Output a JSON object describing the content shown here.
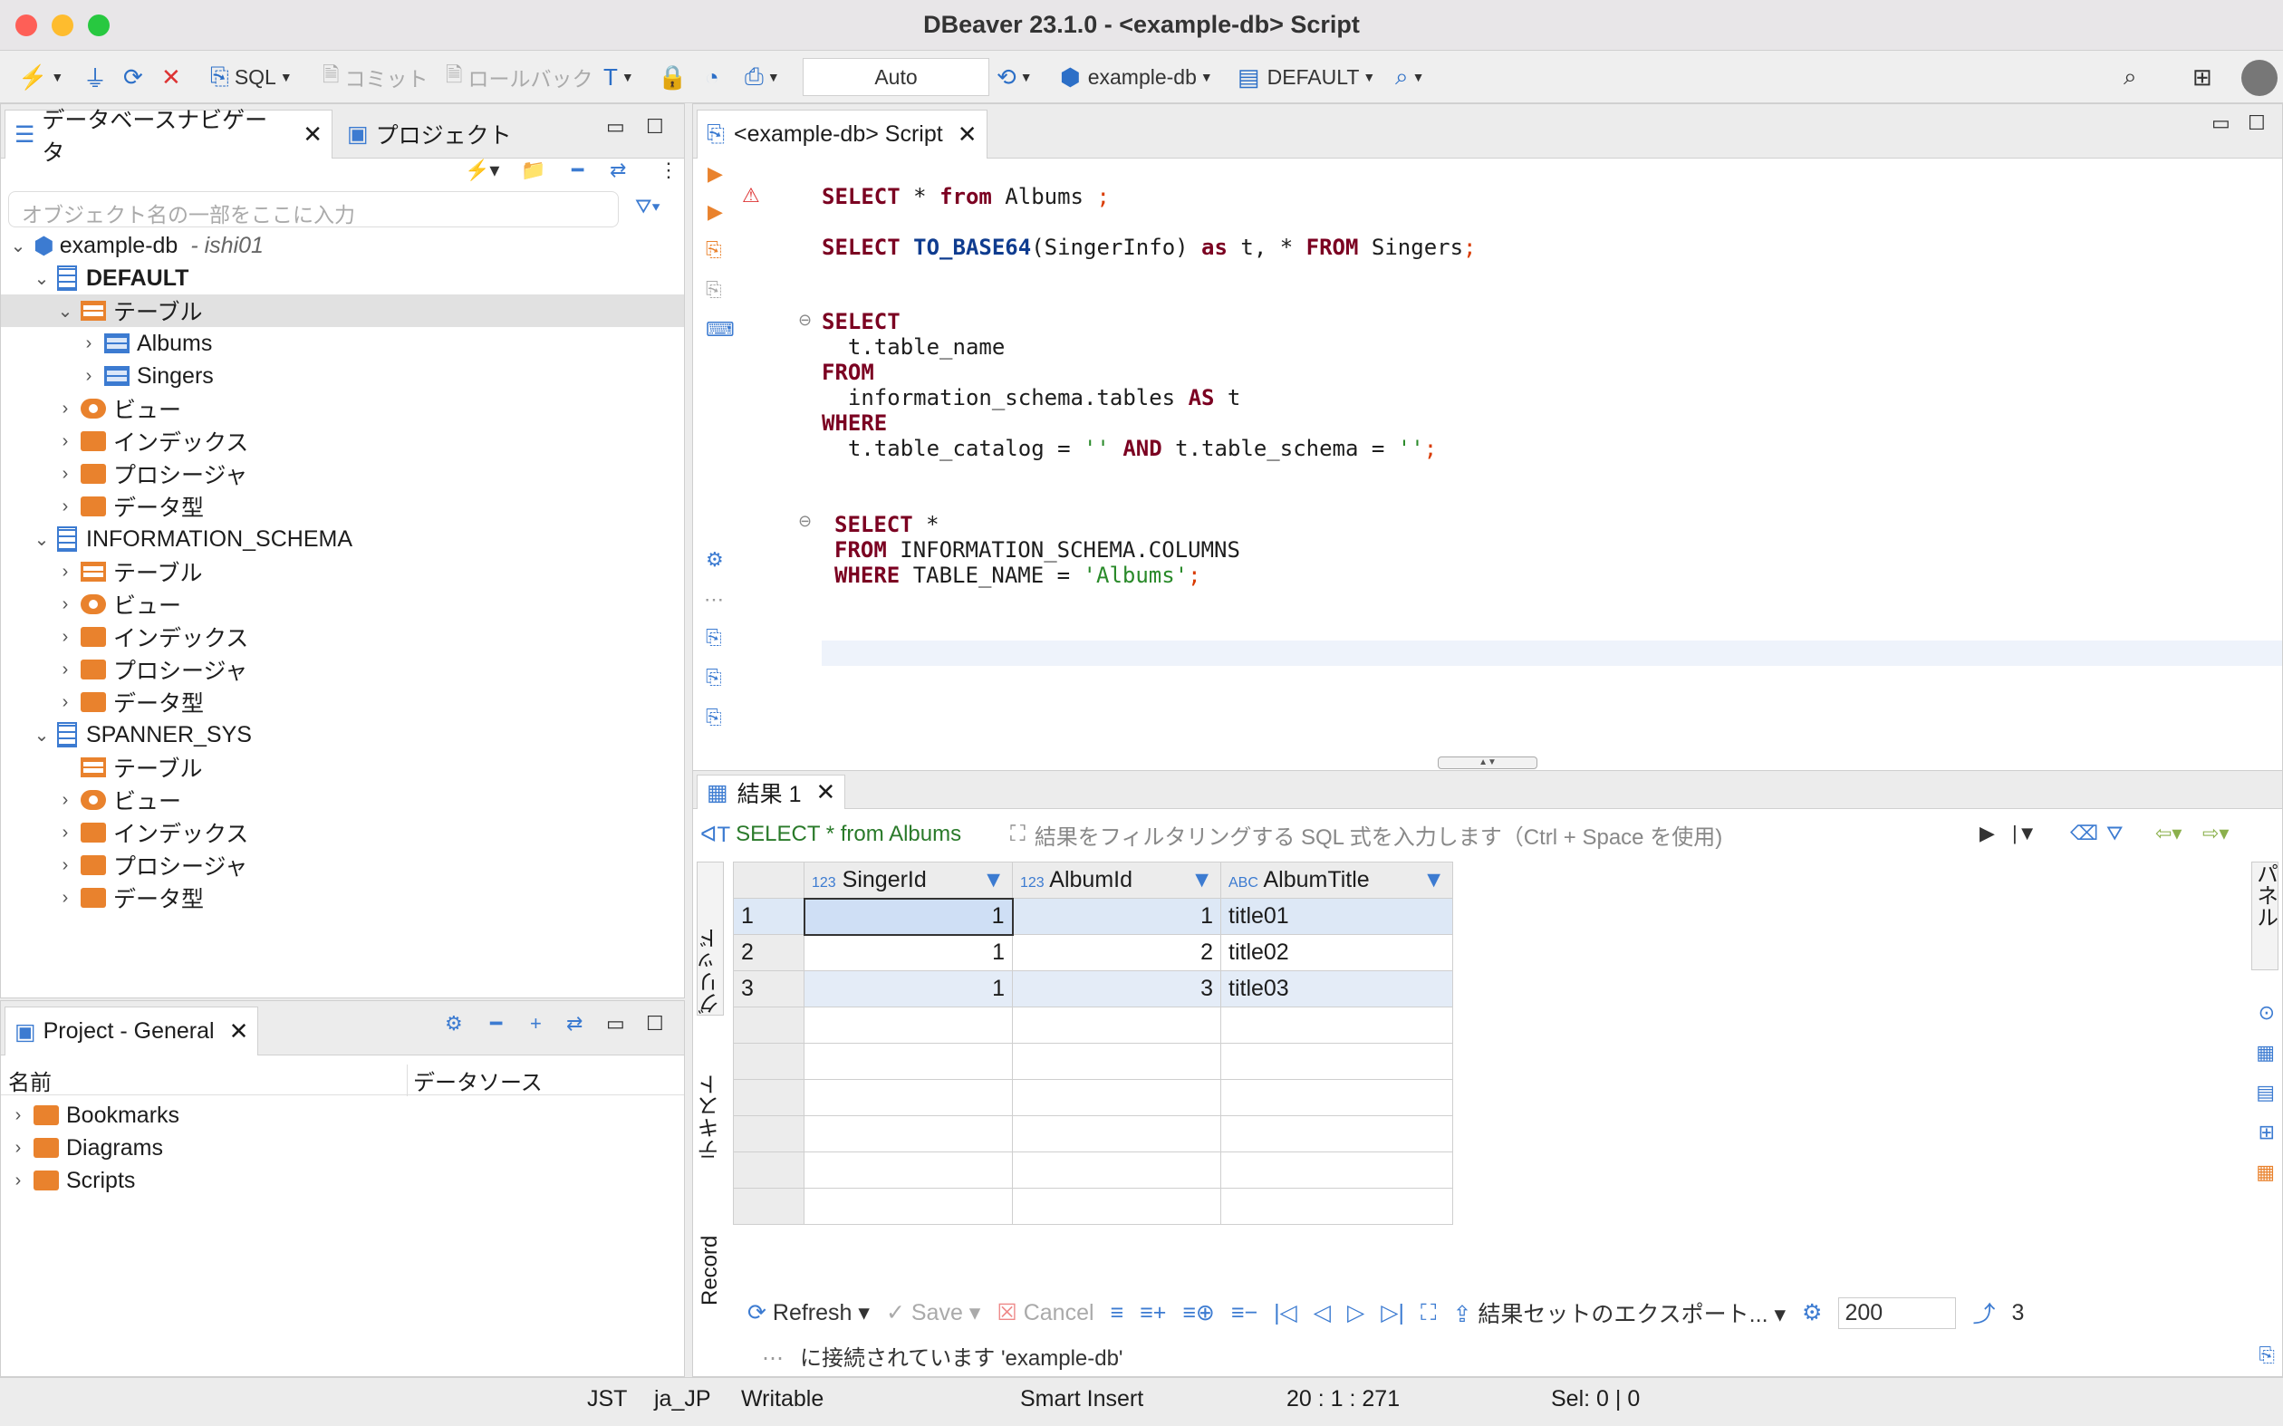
{
  "window": {
    "title": "DBeaver 23.1.0 - <example-db> Script"
  },
  "toolbar": {
    "sql_label": "SQL",
    "commit_label": "コミット",
    "rollback_label": "ロールバック",
    "transaction_mode": "Auto",
    "datasource": "example-db",
    "schema": "DEFAULT"
  },
  "navigator": {
    "tab_label": "データベースナビゲータ",
    "project_tab_label": "プロジェクト",
    "filter_placeholder": "オブジェクト名の一部をここに入力",
    "connection": "example-db",
    "connection_user": "- ishi01",
    "schema_default": "DEFAULT",
    "tables": "テーブル",
    "table_albums": "Albums",
    "table_singers": "Singers",
    "views": "ビュー",
    "indexes": "インデックス",
    "procedures": "プロシージャ",
    "datatypes": "データ型",
    "schema_info": "INFORMATION_SCHEMA",
    "schema_spanner": "SPANNER_SYS"
  },
  "project": {
    "tab_label": "Project - General",
    "col_name": "名前",
    "col_datasource": "データソース",
    "items": [
      "Bookmarks",
      "Diagrams",
      "Scripts"
    ]
  },
  "editor": {
    "tab_label": "<example-db> Script",
    "lines": {
      "q1_select": "SELECT",
      "q1_star": " * ",
      "q1_from": "from",
      "q1_rest": " Albums ",
      "q1_semi": ";",
      "q2_select": "SELECT",
      "q2_fn": "TO_BASE64",
      "q2_args": "(SingerInfo) ",
      "q2_as": "as",
      "q2_mid": " t, * ",
      "q2_from": "FROM",
      "q2_rest": " Singers",
      "q2_semi": ";",
      "q3_select": "SELECT",
      "q3_col": "  t.table_name",
      "q3_from": "FROM",
      "q3_tbl": "  information_schema.tables ",
      "q3_as": "AS",
      "q3_alias": " t",
      "q3_where": "WHERE",
      "q3_cond1": "  t.table_catalog = ",
      "q3_str1": "''",
      "q3_and": "AND",
      "q3_cond2": " t.table_schema = ",
      "q3_str2": "''",
      "q3_semi": ";",
      "q4_select": "SELECT",
      "q4_star": " *",
      "q4_from": "FROM",
      "q4_tbl": " INFORMATION_SCHEMA.COLUMNS",
      "q4_where": "WHERE",
      "q4_cond": " TABLE_NAME = ",
      "q4_str": "'Albums'",
      "q4_semi": ";"
    }
  },
  "results": {
    "tab_label": "結果 1",
    "query_label": "SELECT * from Albums",
    "filter_placeholder": "結果をフィルタリングする SQL 式を入力します（Ctrl + Space を使用)",
    "columns": [
      "SingerId",
      "AlbumId",
      "AlbumTitle"
    ],
    "rows": [
      {
        "n": "1",
        "singer": "1",
        "album": "1",
        "title": "title01"
      },
      {
        "n": "2",
        "singer": "1",
        "album": "2",
        "title": "title02"
      },
      {
        "n": "3",
        "singer": "1",
        "album": "3",
        "title": "title03"
      }
    ],
    "side_grid": "グリッド",
    "side_text": "テキスト",
    "side_record": "Record",
    "side_panel": "パネル",
    "refresh": "Refresh",
    "save": "Save",
    "cancel": "Cancel",
    "export": "結果セットのエクスポート...",
    "fetch_size": "200",
    "row_count": "3",
    "connection_status": "に接続されています 'example-db'"
  },
  "statusbar": {
    "tz": "JST",
    "locale": "ja_JP",
    "mode": "Writable",
    "insert": "Smart Insert",
    "pos": "20 : 1 : 271",
    "sel": "Sel: 0 | 0"
  }
}
